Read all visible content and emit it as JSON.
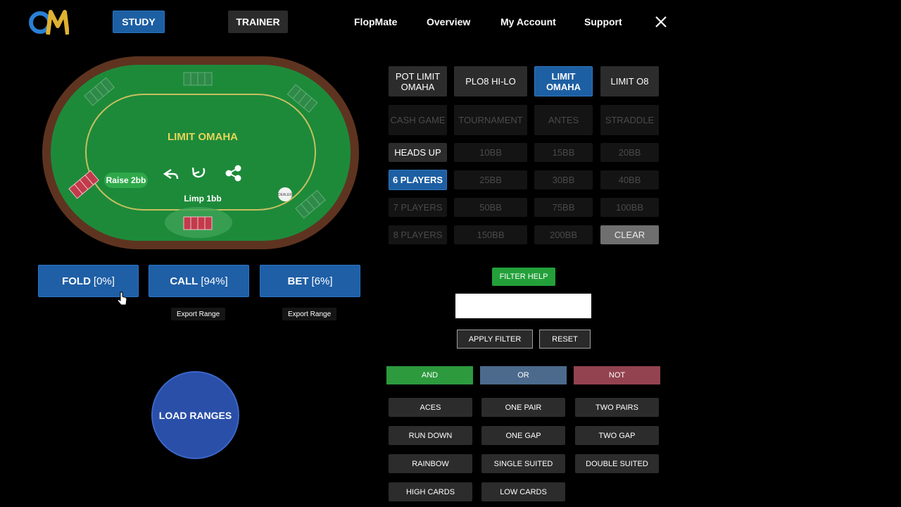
{
  "nav": {
    "logo_text": "OM",
    "study": "STUDY",
    "trainer": "TRAINER",
    "links": [
      "FlopMate",
      "Overview",
      "My Account",
      "Support"
    ]
  },
  "table": {
    "title": "LIMIT OMAHA",
    "raise_label": "Raise 2bb",
    "limp_label": "Limp 1bb",
    "dealer_label": "DEALER"
  },
  "actions": {
    "fold": {
      "label": "FOLD",
      "pct": "[0%]"
    },
    "call": {
      "label": "CALL",
      "pct": "[94%]"
    },
    "bet": {
      "label": "BET",
      "pct": "[6%]"
    },
    "export_call": "Export Range",
    "export_bet": "Export Range",
    "load_ranges": "LOAD RANGES"
  },
  "game_types": [
    "POT LIMIT OMAHA",
    "PLO8 HI-LO",
    "LIMIT OMAHA",
    "LIMIT O8"
  ],
  "formats": [
    "CASH GAME",
    "TOURNAMENT",
    "ANTES",
    "STRADDLE"
  ],
  "players": [
    "HEADS UP",
    "6 PLAYERS",
    "7 PLAYERS",
    "8 PLAYERS"
  ],
  "stacks": [
    "10BB",
    "15BB",
    "20BB",
    "25BB",
    "30BB",
    "40BB",
    "50BB",
    "75BB",
    "100BB",
    "150BB",
    "200BB"
  ],
  "clear": "CLEAR",
  "filter": {
    "help": "FILTER HELP",
    "value": "",
    "apply": "APPLY FILTER",
    "reset": "RESET"
  },
  "logic": {
    "and": "AND",
    "or": "OR",
    "not": "NOT"
  },
  "hand_filters": [
    "ACES",
    "ONE PAIR",
    "TWO PAIRS",
    "RUN DOWN",
    "ONE GAP",
    "TWO GAP",
    "RAINBOW",
    "SINGLE SUITED",
    "DOUBLE SUITED",
    "HIGH CARDS",
    "LOW CARDS"
  ],
  "colors": {
    "accent_blue": "#1d5fa3",
    "felt_green": "#1d8a3a",
    "rail_brown": "#6b3d22",
    "and_green": "#2c9a3d",
    "or_blue": "#4c6a8c",
    "not_red": "#93434f"
  }
}
